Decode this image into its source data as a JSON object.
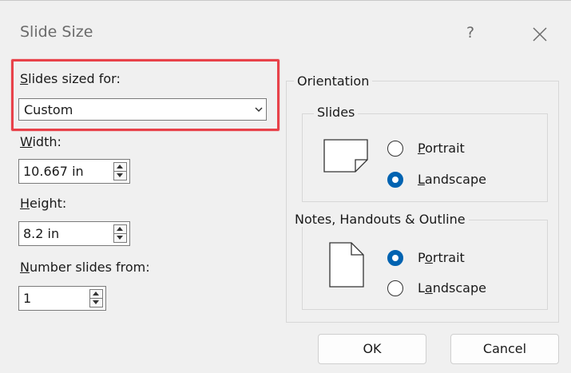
{
  "dialog": {
    "title": "Slide Size",
    "help_label": "?",
    "close_icon": "close-icon"
  },
  "slides_sized_for": {
    "label": "Slides sized for:",
    "value": "Custom",
    "icon": "chevron-down-icon"
  },
  "width": {
    "label": "Width:",
    "value": "10.667 in"
  },
  "height": {
    "label": "Height:",
    "value": "8.2 in"
  },
  "number_slides_from": {
    "label": "Number slides from:",
    "value": "1"
  },
  "orientation": {
    "label": "Orientation",
    "slides": {
      "label": "Slides",
      "icon": "landscape-page-icon",
      "options": [
        {
          "label": "Portrait",
          "checked": false
        },
        {
          "label": "Landscape",
          "checked": true
        }
      ]
    },
    "notes": {
      "label": "Notes, Handouts & Outline",
      "icon": "portrait-page-icon",
      "options": [
        {
          "label": "Portrait",
          "checked": true
        },
        {
          "label": "Landscape",
          "checked": false
        }
      ]
    }
  },
  "buttons": {
    "ok": "OK",
    "cancel": "Cancel"
  },
  "colors": {
    "highlight": "#e8424a",
    "radio_selected": "#0063b1",
    "background": "#f0f0f0"
  }
}
